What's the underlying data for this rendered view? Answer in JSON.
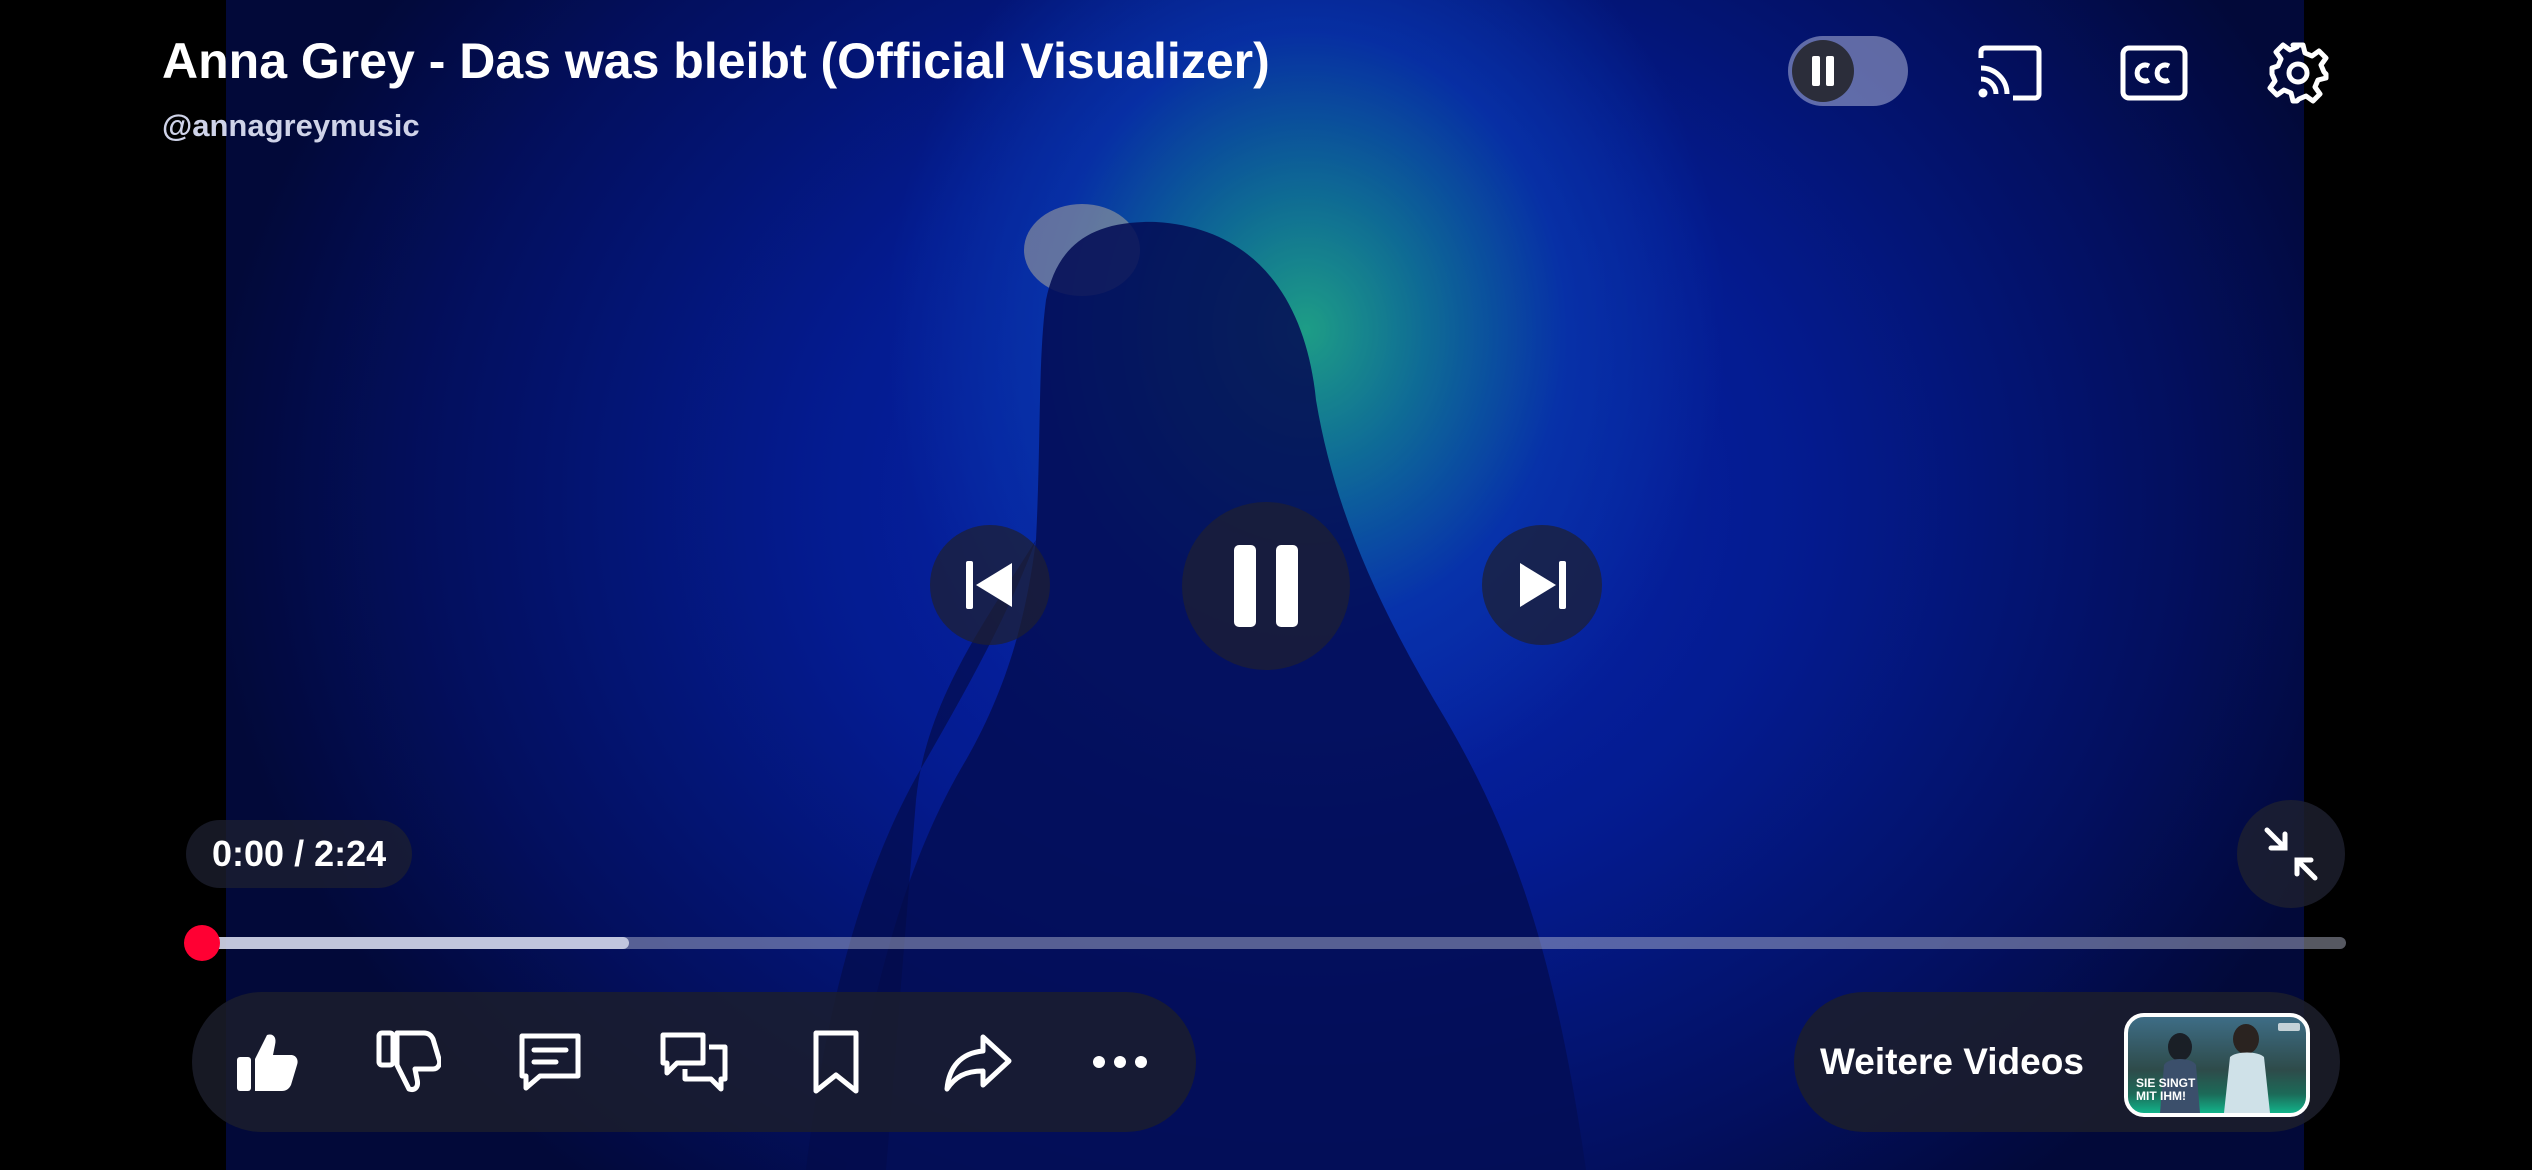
{
  "video": {
    "title": "Anna Grey - Das was bleibt (Official Visualizer)",
    "channel": "@annagreymusic"
  },
  "top_controls": {
    "autoplay": "pause-icon",
    "cast": "cast-icon",
    "captions": "cc-icon",
    "settings": "gear-icon"
  },
  "playback": {
    "current_time": "0:00",
    "separator": " / ",
    "duration": "2:24",
    "progress_fraction": 0.0,
    "buffered_fraction": 0.2
  },
  "center_controls": [
    "previous-icon",
    "pause-icon",
    "next-icon"
  ],
  "actions": [
    "like-icon",
    "dislike-icon",
    "comment-icon",
    "live-chat-icon",
    "save-icon",
    "share-icon",
    "more-icon"
  ],
  "more_videos": {
    "label": "Weitere Videos",
    "thumbnail_caption": "SIE SINGT MIT IHM!"
  },
  "colors": {
    "accent": "#ff0033",
    "glow": "#28d2aa",
    "background_blue": "#0a35e6"
  }
}
